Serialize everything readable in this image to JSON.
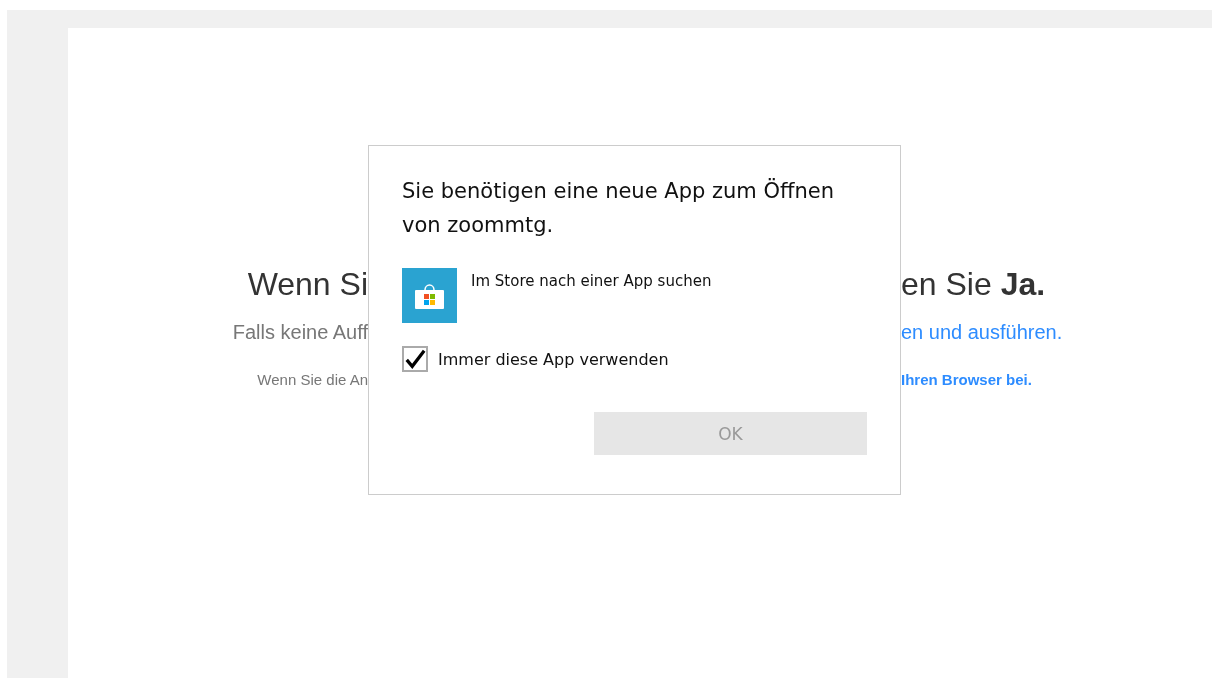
{
  "page": {
    "heading_left": "Wenn Si",
    "heading_right": "en Sie **Ja.**",
    "prompt_left": "Falls keine Auff",
    "prompt_link": "en und ausführen.",
    "note_left": "Wenn Sie die An",
    "note_link": "Ihren Browser bei."
  },
  "dialog": {
    "title": "Sie benötigen eine neue App zum Öffnen von zoommtg.",
    "store_option": "Im Store nach einer App suchen",
    "always_use": {
      "label": "Immer diese App verwenden",
      "checked": true
    },
    "ok_button": {
      "label": "OK",
      "disabled": true
    }
  }
}
